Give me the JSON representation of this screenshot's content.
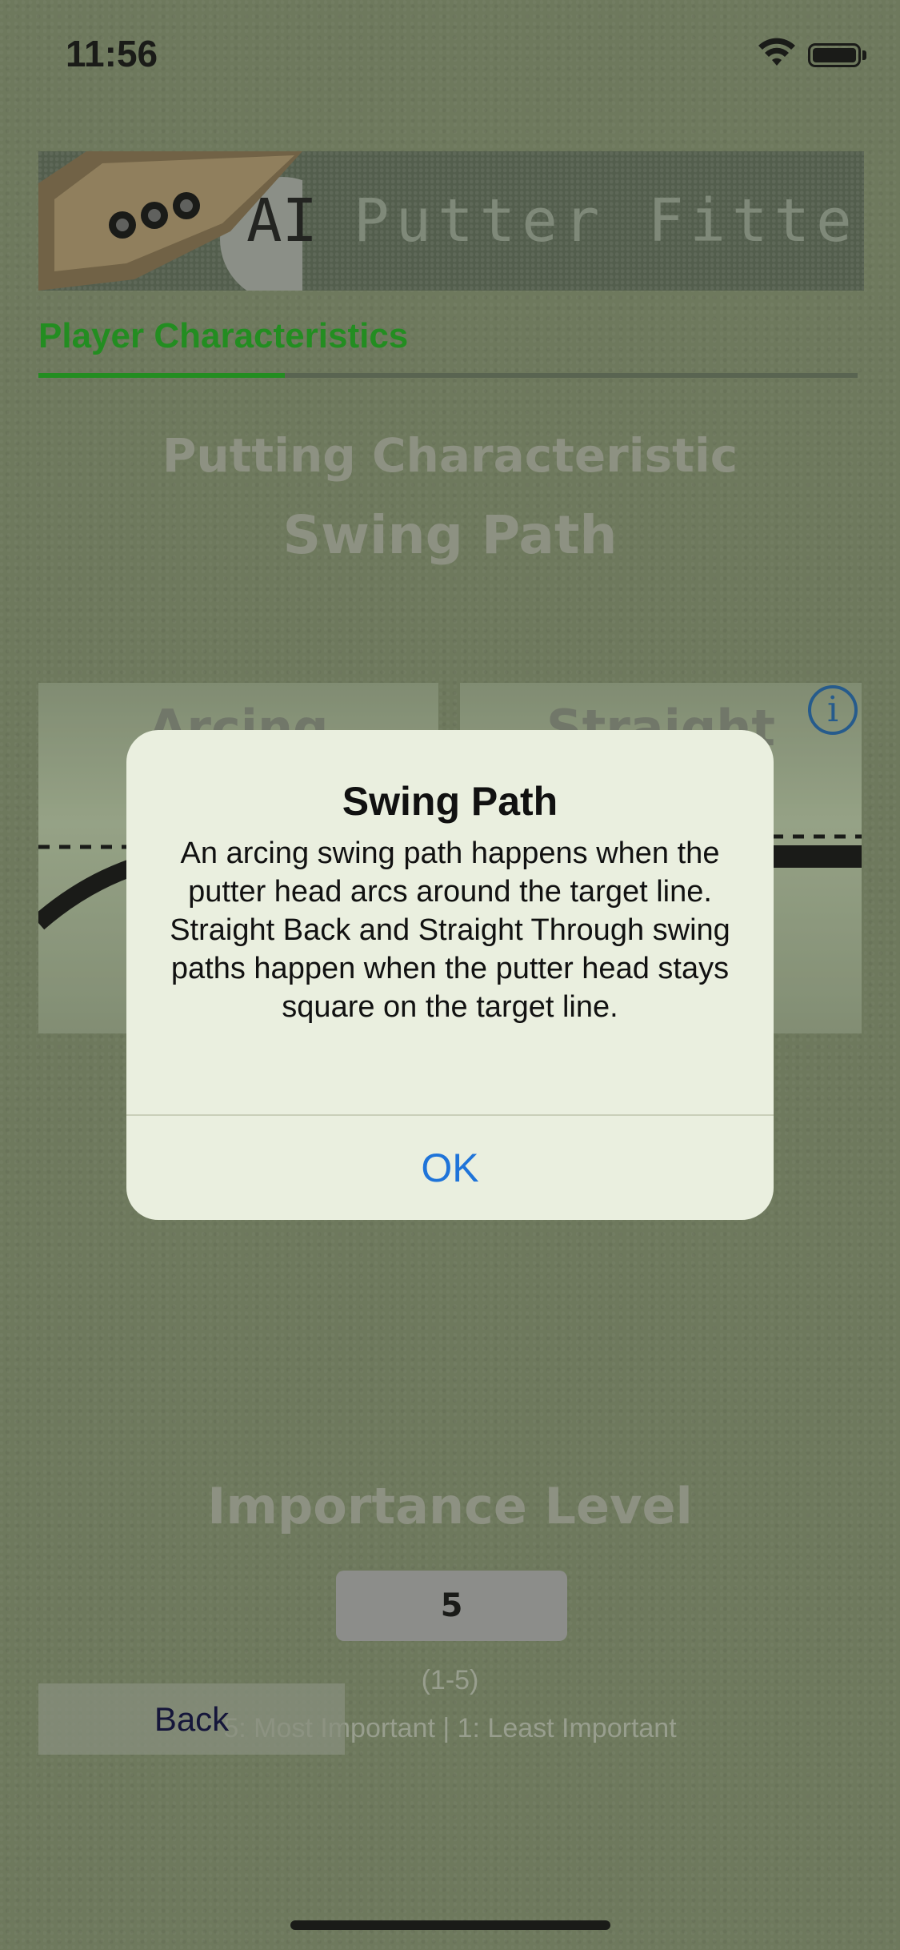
{
  "status_bar": {
    "time": "11:56"
  },
  "banner": {
    "ai": "AI",
    "title": "Putter Fitter"
  },
  "section_tab": {
    "label": "Player Characteristics"
  },
  "heading": {
    "line1": "Putting Characteristic",
    "line2": "Swing Path"
  },
  "options": [
    {
      "label": "Arcing"
    },
    {
      "label": "Straight"
    }
  ],
  "info_icon": "info-circle-icon",
  "importance": {
    "title": "Importance Level",
    "value": "5",
    "range": "(1-5)",
    "scale": "5: Most Important   |  1: Least Important"
  },
  "back_button": {
    "label": "Back"
  },
  "alert": {
    "title": "Swing Path",
    "message": "An arcing swing path happens when the putter head arcs around the target line.\n Straight Back and Straight Through swing paths happen when the putter head stays square on the target line.",
    "ok_label": "OK"
  },
  "colors": {
    "accent_green": "#1c9c1c",
    "ios_blue": "#1f74d9",
    "background": "#778365"
  }
}
